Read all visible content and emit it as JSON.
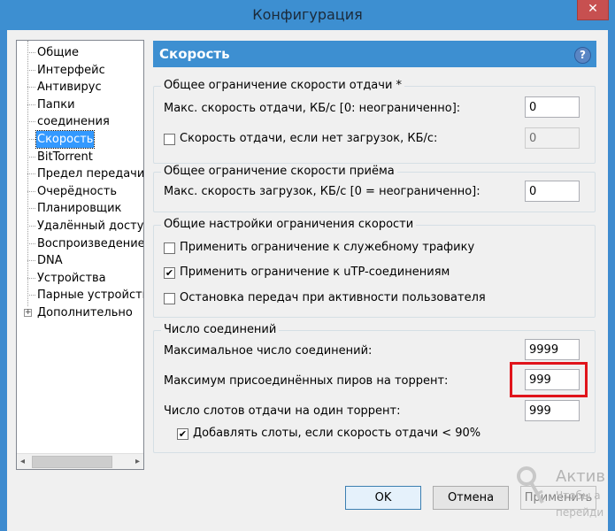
{
  "window": {
    "title": "Конфигурация",
    "close_glyph": "✕"
  },
  "tree": {
    "items": [
      {
        "label": "Общие",
        "selected": false
      },
      {
        "label": "Интерфейс",
        "selected": false
      },
      {
        "label": "Антивирус",
        "selected": false
      },
      {
        "label": "Папки",
        "selected": false
      },
      {
        "label": "соединения",
        "selected": false
      },
      {
        "label": "Скорость",
        "selected": true
      },
      {
        "label": "BitTorrent",
        "selected": false
      },
      {
        "label": "Предел передачи",
        "selected": false
      },
      {
        "label": "Очерёдность",
        "selected": false
      },
      {
        "label": "Планировщик",
        "selected": false
      },
      {
        "label": "Удалённый доступ",
        "selected": false
      },
      {
        "label": "Воспроизведение",
        "selected": false
      },
      {
        "label": "DNA",
        "selected": false
      },
      {
        "label": "Устройства",
        "selected": false
      },
      {
        "label": "Парные устройства",
        "selected": false
      },
      {
        "label": "Дополнительно",
        "selected": false,
        "expander": "+"
      }
    ],
    "scroll_left": "◂",
    "scroll_right": "▸"
  },
  "panel": {
    "title": "Скорость",
    "help_glyph": "?",
    "upload_group": {
      "title": "Общее ограничение скорости отдачи *",
      "max_upload_label": "Макс. скорость отдачи, КБ/с [0: неограниченно]:",
      "max_upload_value": "0",
      "no_download_label": "Скорость отдачи, если нет загрузок, КБ/с:",
      "no_download_checked": false,
      "no_download_value": "0"
    },
    "download_group": {
      "title": "Общее ограничение скорости приёма",
      "max_download_label": "Макс. скорость загрузок, КБ/с [0 = неограниченно]:",
      "max_download_value": "0"
    },
    "general_group": {
      "title": "Общие настройки ограничения скорости",
      "overhead_label": "Применить ограничение к служебному трафику",
      "overhead_checked": false,
      "utp_label": "Применить ограничение к uTP-соединениям",
      "utp_checked": true,
      "utp_check_glyph": "✔",
      "idle_label": "Остановка передач при активности пользователя",
      "idle_checked": false
    },
    "connections_group": {
      "title": "Число соединений",
      "max_conn_label": "Максимальное число соединений:",
      "max_conn_value": "9999",
      "max_peers_label": "Максимум присоединённых пиров на торрент:",
      "max_peers_value": "999",
      "upload_slots_label": "Число слотов отдачи на один торрент:",
      "upload_slots_value": "999",
      "extra_slots_label": "Добавлять слоты, если скорость отдачи < 90%",
      "extra_slots_checked": true,
      "extra_slots_glyph": "✔"
    }
  },
  "buttons": {
    "ok": "OK",
    "cancel": "Отмена",
    "apply": "Применить"
  },
  "watermark": {
    "line1": "Актив",
    "line2": "Чтобы а",
    "line3": "перейди"
  },
  "colors": {
    "titlebar": "#3d8fd1",
    "header": "#3d8fd1",
    "highlight": "#e0141b",
    "selection": "#3399ff"
  }
}
